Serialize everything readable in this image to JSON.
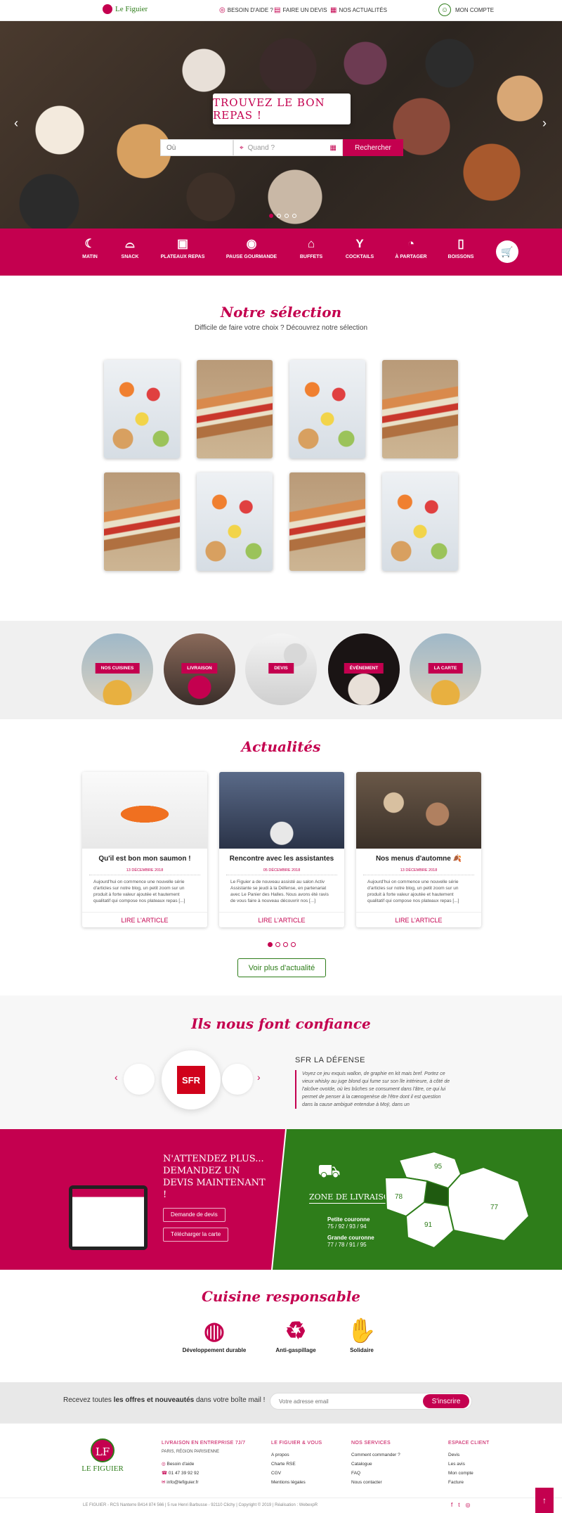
{
  "header": {
    "brand": "Le Figuier",
    "links": [
      {
        "label": "Besoin d'aide ?",
        "icon": "lifebuoy-icon"
      },
      {
        "label": "Faire un devis",
        "icon": "document-icon"
      },
      {
        "label": "Nos actualités",
        "icon": "news-icon"
      }
    ],
    "account": "Mon compte"
  },
  "hero": {
    "title": "Trouvez le bon repas !",
    "where_placeholder": "Où",
    "when_placeholder": "Quand ?",
    "search_label": "Rechercher"
  },
  "categories": [
    {
      "label": "Matin",
      "icon": "croissant-icon"
    },
    {
      "label": "Snack",
      "icon": "burger-icon"
    },
    {
      "label": "Plateaux repas",
      "icon": "tray-icon"
    },
    {
      "label": "Pause gourmande",
      "icon": "cake-icon"
    },
    {
      "label": "Buffets",
      "icon": "buffet-icon"
    },
    {
      "label": "Cocktails",
      "icon": "cocktail-icon"
    },
    {
      "label": "À partager",
      "icon": "share-platter-icon"
    },
    {
      "label": "Boissons",
      "icon": "bottle-icon"
    }
  ],
  "selection": {
    "title": "Notre sélection",
    "subtitle": "Difficile de faire votre choix ? Découvrez notre sélection"
  },
  "circles": [
    "Nos cuisines",
    "Livraison",
    "Devis",
    "Événement",
    "La carte"
  ],
  "news": {
    "title": "Actualités",
    "read_more": "Lire l'article",
    "more_button": "Voir plus d'actualité",
    "items": [
      {
        "title": "Qu'il est bon mon saumon !",
        "date": "13 décembre 2018",
        "text": "Aujourd'hui on commence une nouvelle série d'articles sur notre blog, un petit zoom sur un produit à forte valeur ajoutée et hautement qualitatif qui compose nos plateaux repas [...]"
      },
      {
        "title": "Rencontre avec les assistantes",
        "date": "05 décembre 2018",
        "text": "Le Figuier a de nouveau assisté au salon Activ Assistante se jeudi à la Défense, en partenariat avec Le Panier des Halles. Nous avons été ravis de vous faire à nouveau découvrir nos [...]"
      },
      {
        "title": "Nos menus d'automne 🍂",
        "date": "13 décembre 2018",
        "text": "Aujourd'hui on commence une nouvelle série d'articles sur notre blog, un petit zoom sur un produit à forte valeur ajoutée et hautement qualitatif qui compose nos plateaux repas [...]"
      }
    ]
  },
  "trust": {
    "title": "Ils nous font confiance",
    "client": "SFR",
    "name": "SFR La Défense",
    "quote": "Voyez ce jeu exquis wallon, de graphie en kit mais bref. Portez ce vieux whisky au juge blond qui fume sur son île intérieure, à côté de l'alcôve ovoïde, où les bûches se consument dans l'âtre, ce qui lui permet de penser à la cænogenèse de l'être dont il est question dans la cause ambiguë entendue à Moÿ, dans un"
  },
  "devis": {
    "title": "N'attendez plus... demandez un devis maintenant !",
    "btn_devis": "Demande de devis",
    "btn_carte": "Télécharger la carte"
  },
  "zone": {
    "title": "Zone de livraison",
    "petite_label": "Petite couronne",
    "petite_val": "75 / 92 / 93 / 94",
    "grande_label": "Grande couronne",
    "grande_val": "77 / 78 / 91 / 95",
    "map_labels": [
      "95",
      "78",
      "91",
      "77"
    ]
  },
  "responsable": {
    "title": "Cuisine responsable",
    "items": [
      {
        "label": "Développement durable",
        "icon": "globe-hand-icon"
      },
      {
        "label": "Anti-gaspillage",
        "icon": "recycle-bin-icon"
      },
      {
        "label": "Solidaire",
        "icon": "handshake-icon"
      }
    ]
  },
  "newsletter": {
    "text_pre": "Recevez toutes ",
    "text_bold": "les offres et nouveautés",
    "text_post": " dans votre boîte mail !",
    "placeholder": "Votre adresse email",
    "button": "S'inscrire"
  },
  "footer": {
    "brand_mark": "LF",
    "brand": "Le Figuier",
    "col1_title": "Livraison en entreprise 7j/7",
    "col1_sub": "Paris, région parisienne",
    "col1_items": [
      "Besoin d'aide",
      "01 47 39 92 92",
      "info@lefiguier.fr"
    ],
    "col2_title": "Le Figuier & vous",
    "col2_items": [
      "A propos",
      "Charte RSE",
      "CGV",
      "Mentions légales"
    ],
    "col3_title": "Nos services",
    "col3_items": [
      "Comment commander ?",
      "Catalogue",
      "FAQ",
      "Nous contacter"
    ],
    "col4_title": "Espace client",
    "col4_items": [
      "Devis",
      "Les avis",
      "Mon compte",
      "Facture"
    ],
    "copyright": "LE FIGUIER - RCS Nanterre B414 874 566 | 5 rue Henri Barbusse - 92110 Clichy | Copyright © 2019 | Réalisation : WebexpR"
  },
  "colors": {
    "accent": "#c4004f",
    "green": "#2e7d1a"
  }
}
